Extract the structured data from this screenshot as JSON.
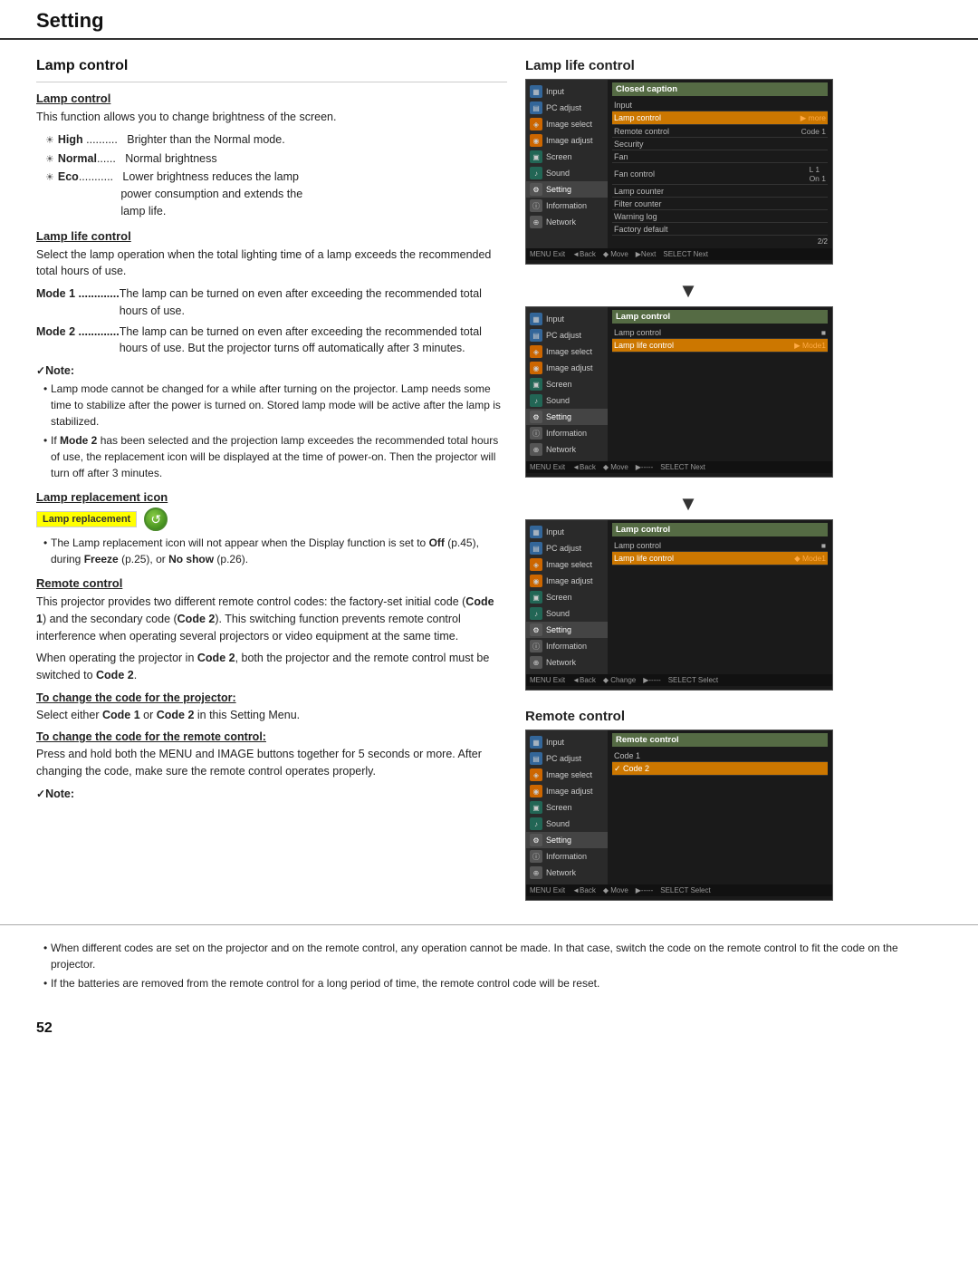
{
  "header": {
    "title": "Setting"
  },
  "page_number": "52",
  "left_col": {
    "lamp_control": {
      "title": "Lamp control",
      "sub_title": "Lamp control",
      "intro": "This function allows you to change brightness of the screen.",
      "modes": [
        {
          "key": "High",
          "dots": ".........",
          "value": "Brighter than the Normal mode."
        },
        {
          "key": "Normal",
          "dots": "......",
          "value": "Normal brightness"
        },
        {
          "key": "Eco",
          "dots": "..........",
          "value": "Lower brightness reduces the lamp power consumption and extends the lamp life."
        }
      ],
      "lamp_life_sub": "Lamp life control",
      "lamp_life_intro": "Select the lamp operation when the total lighting time of a lamp exceeds the recommended total hours of use.",
      "life_modes": [
        {
          "key": "Mode 1",
          "dots": "...............",
          "desc": "The lamp can be turned on even after exceeding the recommended total hours of use."
        },
        {
          "key": "Mode 2",
          "dots": "...............",
          "desc": "The lamp can be turned on even after exceeding the recommended total hours of use. But the projector turns off automatically after 3 minutes."
        }
      ],
      "note_title": "✓Note:",
      "notes": [
        "Lamp mode cannot be changed for a while after turning on the projector. Lamp needs some time to stabilize after the power is turned on. Stored lamp mode will be active after the lamp is stabilized.",
        "If Mode 2 has been selected and the projection lamp exceedes the recommended total hours of use, the replacement icon will be displayed at the time of power-on. Then the projector will turn off after 3 minutes."
      ],
      "lamp_replacement_label": "Lamp replacement icon",
      "lamp_label_text": "Lamp replacement",
      "lamp_notes": [
        "The Lamp replacement icon will not appear when the Display function is set to Off (p.45), during Freeze (p.25), or No show (p.26)."
      ]
    },
    "remote_control": {
      "sub_title": "Remote control",
      "intro": "This projector provides two different remote control codes: the factory-set initial code (Code 1) and the secondary code (Code 2). This switching function prevents remote control interference when operating several projectors or video equipment at the same time.",
      "para2": "When operating the projector in Code 2, both the projector and the remote control must be switched to Code 2.",
      "change_projector_label": "To change the code for the projector:",
      "change_projector_text": "Select either Code 1 or Code 2 in this Setting Menu.",
      "change_remote_label": "To change the code for the remote control:",
      "change_remote_text": "Press and hold both the MENU and IMAGE buttons together for 5 seconds or more.  After changing the code, make sure the  remote control operates properly.",
      "note2_title": "✓Note:",
      "notes2": [
        "When different codes are set on the projector and on the remote control, any operation cannot be made. In that case,  switch the code on the remote control to fit the code on the projector.",
        "If the batteries are removed from the remote control for a long period of time, the remote control code will be reset."
      ]
    }
  },
  "right_col": {
    "lamp_life_control_title": "Lamp life control",
    "remote_control_title": "Remote control",
    "ui_screen1": {
      "content_title": "Closed caption",
      "page_indicator": "2/2",
      "sidebar_items": [
        {
          "label": "Input",
          "icon": "blue"
        },
        {
          "label": "PC adjust",
          "icon": "blue"
        },
        {
          "label": "Image select",
          "icon": "orange"
        },
        {
          "label": "Image adjust",
          "icon": "orange"
        },
        {
          "label": "Screen",
          "icon": "teal"
        },
        {
          "label": "Sound",
          "icon": "teal"
        },
        {
          "label": "Setting",
          "icon": "gray2",
          "active": true
        },
        {
          "label": "Information",
          "icon": "gray2"
        },
        {
          "label": "Network",
          "icon": "gray2"
        }
      ],
      "menu_items": [
        {
          "label": "Input",
          "value": ""
        },
        {
          "label": "Lamp control",
          "value": "▶ more",
          "highlight": true
        },
        {
          "label": "Remote control",
          "value": "Code 1"
        },
        {
          "label": "Security",
          "value": ""
        },
        {
          "label": "Fan",
          "value": ""
        },
        {
          "label": "Fan control",
          "value": "L 1\nOn 1"
        },
        {
          "label": "Lamp counter",
          "value": ""
        },
        {
          "label": "Filter counter",
          "value": ""
        },
        {
          "label": "Warning log",
          "value": ""
        },
        {
          "label": "Factory default",
          "value": ""
        }
      ],
      "footer": [
        "MENU Exit",
        "◄Back",
        "◆ Move",
        "▶Next",
        "SELECT Next"
      ]
    },
    "ui_screen2": {
      "content_title": "Lamp control",
      "sidebar_items": [
        {
          "label": "Input",
          "icon": "blue"
        },
        {
          "label": "PC adjust",
          "icon": "blue"
        },
        {
          "label": "Image select",
          "icon": "orange"
        },
        {
          "label": "Image adjust",
          "icon": "orange"
        },
        {
          "label": "Screen",
          "icon": "teal"
        },
        {
          "label": "Sound",
          "icon": "teal"
        },
        {
          "label": "Setting",
          "icon": "gray2",
          "active": true
        },
        {
          "label": "Information",
          "icon": "gray2"
        },
        {
          "label": "Network",
          "icon": "gray2"
        }
      ],
      "menu_items": [
        {
          "label": "Lamp control",
          "value": "■"
        },
        {
          "label": "Lamp life control",
          "value": "▶ Mode1",
          "highlight": true
        }
      ],
      "footer": [
        "MENU Exit",
        "◄Back",
        "◆ Move",
        "▶-----",
        "SELECT Next"
      ]
    },
    "ui_screen3": {
      "content_title": "Lamp control",
      "sidebar_items": [
        {
          "label": "Input",
          "icon": "blue"
        },
        {
          "label": "PC adjust",
          "icon": "blue"
        },
        {
          "label": "Image select",
          "icon": "orange"
        },
        {
          "label": "Image adjust",
          "icon": "orange"
        },
        {
          "label": "Screen",
          "icon": "teal"
        },
        {
          "label": "Sound",
          "icon": "teal"
        },
        {
          "label": "Setting",
          "icon": "gray2",
          "active": true
        },
        {
          "label": "Information",
          "icon": "gray2"
        },
        {
          "label": "Network",
          "icon": "gray2"
        }
      ],
      "menu_items": [
        {
          "label": "Lamp control",
          "value": "■"
        },
        {
          "label": "Lamp life control",
          "value": "◆ Mode1",
          "highlight": true
        }
      ],
      "footer": [
        "MENU Exit",
        "◄Back",
        "◆ Change",
        "▶-----",
        "SELECT Select"
      ]
    },
    "ui_screen4": {
      "content_title": "Remote control",
      "sidebar_items": [
        {
          "label": "Input",
          "icon": "blue"
        },
        {
          "label": "PC adjust",
          "icon": "blue"
        },
        {
          "label": "Image select",
          "icon": "orange"
        },
        {
          "label": "Image adjust",
          "icon": "orange"
        },
        {
          "label": "Screen",
          "icon": "teal"
        },
        {
          "label": "Sound",
          "icon": "teal"
        },
        {
          "label": "Setting",
          "icon": "gray2",
          "active": true
        },
        {
          "label": "Information",
          "icon": "gray2"
        },
        {
          "label": "Network",
          "icon": "gray2"
        }
      ],
      "menu_items": [
        {
          "label": "Code 1",
          "value": ""
        },
        {
          "label": "✓ Code 2",
          "value": "",
          "highlight": true
        }
      ],
      "footer": [
        "MENU Exit",
        "◄Back",
        "◆ Move",
        "▶-----",
        "SELECT Select"
      ]
    }
  }
}
